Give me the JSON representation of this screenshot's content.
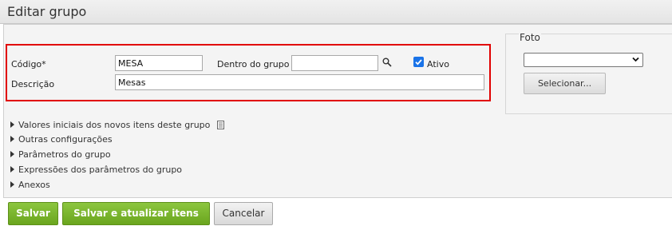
{
  "window": {
    "title": "Editar grupo"
  },
  "form": {
    "codigo_label": "Código*",
    "codigo_value": "MESA",
    "dentro_grupo_label": "Dentro do grupo",
    "dentro_grupo_value": "",
    "ativo_label": "Ativo",
    "ativo_checked": true,
    "descricao_label": "Descrição",
    "descricao_value": "Mesas"
  },
  "foto": {
    "legend": "Foto",
    "select_value": "",
    "select_button": "Selecionar..."
  },
  "sections": [
    {
      "label": "Valores iniciais dos novos itens deste grupo"
    },
    {
      "label": "Outras configurações"
    },
    {
      "label": "Parâmetros do grupo"
    },
    {
      "label": "Expressões dos parâmetros do grupo"
    },
    {
      "label": "Anexos"
    }
  ],
  "actions": {
    "save": "Salvar",
    "save_update": "Salvar e atualizar itens",
    "cancel": "Cancelar"
  },
  "colors": {
    "highlight_border": "#e10000",
    "primary_button": "#7ab42c",
    "checkbox": "#1a73e8"
  },
  "icons": [
    "search-icon",
    "document-icon",
    "check-icon",
    "chevron-down-icon",
    "expand-triangle-icon"
  ]
}
